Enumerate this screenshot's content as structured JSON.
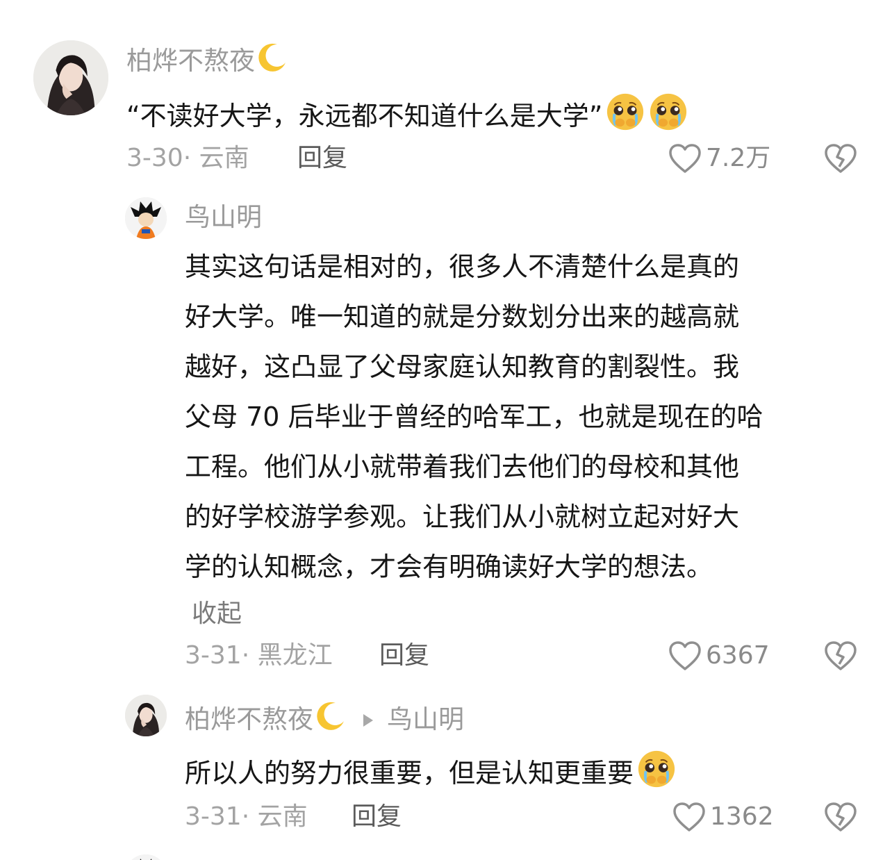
{
  "comment": {
    "username": "柏烨不熬夜",
    "text": "“不读好大学，永远都不知道什么是大学”",
    "date_location": "3-30· 云南",
    "reply_label": "回复",
    "likes": "7.2万"
  },
  "reply1": {
    "username": "鸟山明",
    "lines": [
      "其实这句话是相对的，很多人不清楚什么是真的",
      "好大学。唯一知道的就是分数划分出来的越高就",
      "越好，这凸显了父母家庭认知教育的割裂性。我",
      "父母 70 后毕业于曾经的哈军工，也就是现在的哈",
      "工程。他们从小就带着我们去他们的母校和其他",
      "的好学校游学参观。让我们从小就树立起对好大",
      "学的认知概念，才会有明确读好大学的想法。"
    ],
    "collapse_label": "收起",
    "date_location": "3-31· 黑龙江",
    "reply_label": "回复",
    "likes": "6367"
  },
  "reply2": {
    "username": "柏烨不熬夜",
    "reply_to": "鸟山明",
    "text": "所以人的努力很重要，但是认知更重要",
    "date_location": "3-31· 云南",
    "reply_label": "回复",
    "likes": "1362"
  },
  "icons": {
    "like": "heart-outline-icon",
    "dislike": "broken-heart-icon",
    "moon": "crescent-moon-emoji",
    "emoji": "pleading-face-emoji"
  },
  "colors": {
    "username": "#9a9a9a",
    "meta": "#a3a3a3",
    "text": "#161616",
    "emoji_face": "#f6c343"
  }
}
